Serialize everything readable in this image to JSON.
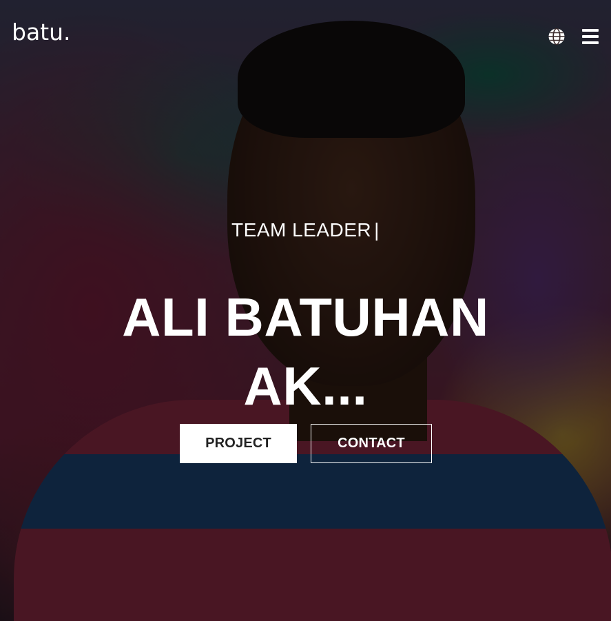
{
  "header": {
    "logo_text": "batu.",
    "language_icon": "globe-icon",
    "menu_icon": "hamburger-menu-icon"
  },
  "hero": {
    "subtitle": "TEAM LEADER",
    "cursor": "|",
    "name_line1": "ALI BATUHAN",
    "name_line2": "AK...",
    "primary_button": "PROJECT",
    "secondary_button": "CONTACT"
  },
  "colors": {
    "text": "#ffffff",
    "primary_button_bg": "#ffffff",
    "primary_button_text": "#222222",
    "overlay": "rgba(0,0,0,0.55)"
  }
}
